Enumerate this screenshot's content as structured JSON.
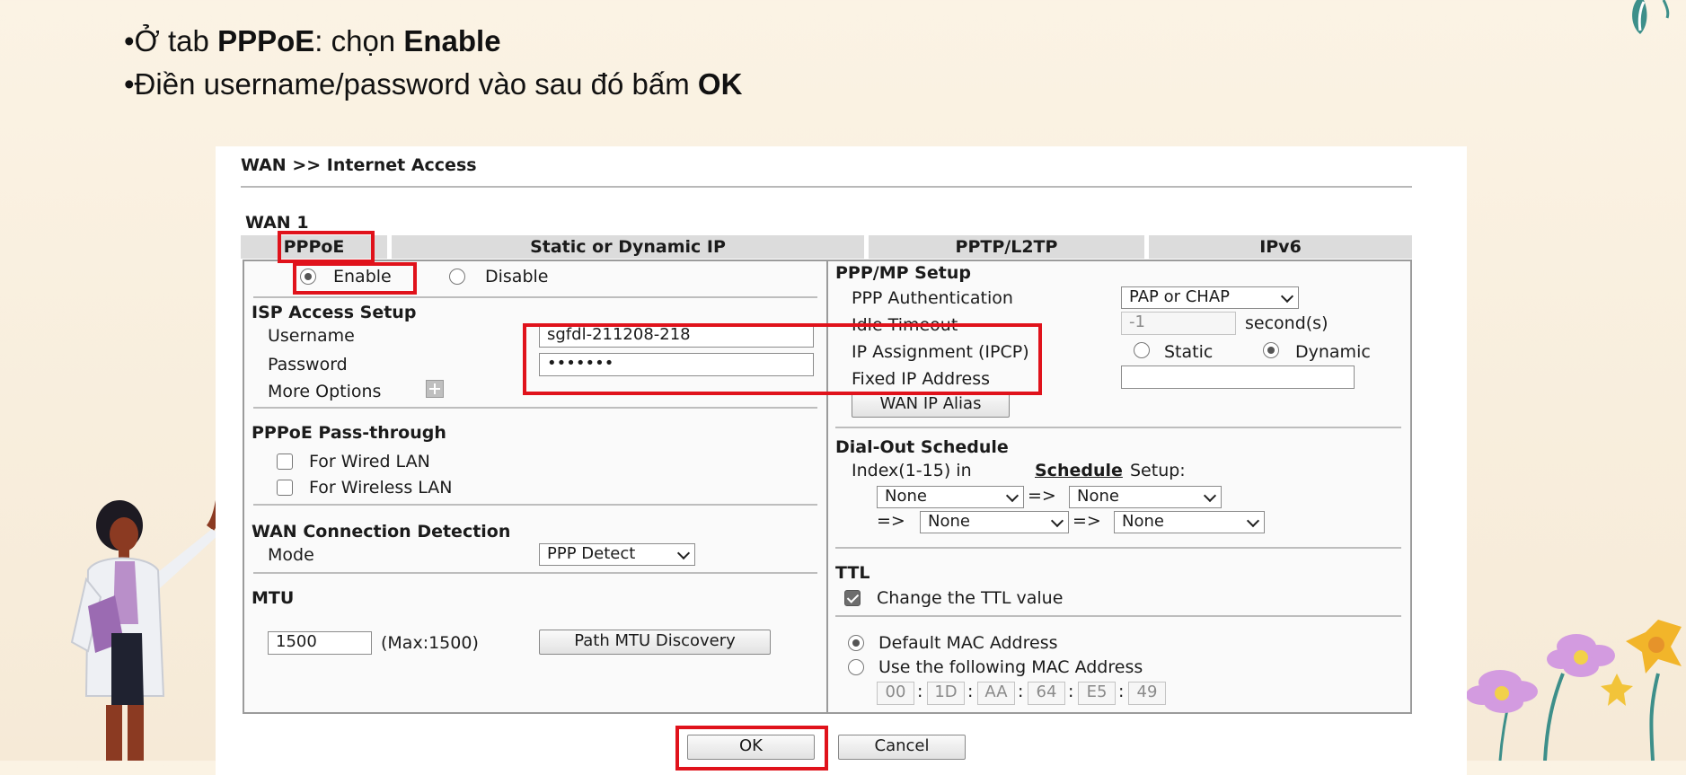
{
  "slide": {
    "bullet1": {
      "pre": "•Ở tab ",
      "b1": "PPPoE",
      "mid": ": chọn ",
      "b2": "Enable"
    },
    "bullet2": {
      "pre": "•Điền username/password vào sau đó bấm ",
      "b1": "OK"
    }
  },
  "router": {
    "breadcrumb": "WAN >> Internet Access",
    "wan_label": "WAN 1",
    "tabs": [
      "PPPoE",
      "Static or Dynamic IP",
      "PPTP/L2TP",
      "IPv6"
    ],
    "enable_label": "Enable",
    "disable_label": "Disable",
    "isp": {
      "heading": "ISP Access Setup",
      "username_label": "Username",
      "username_value": "sgfdl-211208-218",
      "password_label": "Password",
      "password_value": "•••••••",
      "more_options_label": "More Options"
    },
    "passthrough": {
      "heading": "PPPoE Pass-through",
      "wired_label": "For Wired LAN",
      "wireless_label": "For Wireless LAN"
    },
    "detection": {
      "heading": "WAN Connection Detection",
      "mode_label": "Mode",
      "mode_value": "PPP Detect"
    },
    "mtu": {
      "heading": "MTU",
      "value": "1500",
      "max_label": "(Max:1500)",
      "discovery_button": "Path MTU Discovery"
    },
    "ppp": {
      "heading": "PPP/MP Setup",
      "auth_label": "PPP Authentication",
      "auth_value": "PAP or CHAP",
      "idle_label": "Idle Timeout",
      "idle_value": "-1",
      "idle_unit": "second(s)",
      "ipcp_label": "IP Assignment (IPCP)",
      "static_label": "Static",
      "dynamic_label": "Dynamic",
      "fixed_ip_label": "Fixed IP Address",
      "fixed_ip_value": "",
      "alias_button": "WAN IP Alias"
    },
    "dialout": {
      "heading": "Dial-Out Schedule",
      "index_label": "Index(1-15) in",
      "schedule_link": "Schedule",
      "setup_label": "Setup:",
      "arrow": "=>",
      "s1": "None",
      "s2": "None",
      "s3": "None",
      "s4": "None"
    },
    "ttl": {
      "heading": "TTL",
      "change_label": "Change the TTL value"
    },
    "mac": {
      "default_label": "Default MAC Address",
      "use_label": "Use the following MAC Address",
      "octets": [
        "00",
        "1D",
        "AA",
        "64",
        "E5",
        "49"
      ],
      "sep": ":"
    },
    "ok_button": "OK",
    "cancel_button": "Cancel"
  },
  "colors": {
    "highlight": "#e0121b",
    "background": "#fbf3e4"
  }
}
